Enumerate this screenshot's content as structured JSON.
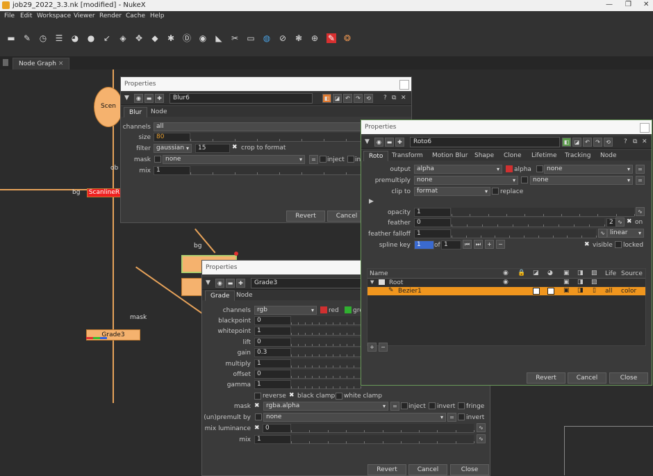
{
  "window": {
    "title": "job29_2022_3.3.nk [modified] - NukeX"
  },
  "menu": [
    "File",
    "Edit",
    "Workspace",
    "Viewer",
    "Render",
    "Cache",
    "Help"
  ],
  "nodegraph": {
    "tab": "Node Graph",
    "labels": {
      "ob": "ob",
      "bg_left": "bg",
      "scanline": "ScanlineR",
      "bg_mid": "bg",
      "mask": "mask",
      "grade_node": "Grade3",
      "scene": "Scen"
    }
  },
  "blur_panel": {
    "title": "Properties",
    "node_name": "Blur6",
    "tabs": [
      "Blur",
      "Node"
    ],
    "channels": {
      "label": "channels",
      "value": "all"
    },
    "size": {
      "label": "size",
      "value": "80"
    },
    "filter": {
      "label": "filter",
      "value": "gaussian",
      "quality": "15",
      "crop_label": "crop to format"
    },
    "mask": {
      "label": "mask",
      "value": "none",
      "inject_label": "inject",
      "invert_label": "in"
    },
    "mix": {
      "label": "mix",
      "value": "1"
    },
    "buttons": {
      "revert": "Revert",
      "cancel": "Cancel"
    }
  },
  "grade_panel": {
    "title": "Properties",
    "node_name": "Grade3",
    "tabs": [
      "Grade",
      "Node"
    ],
    "channels": {
      "label": "channels",
      "value": "rgb",
      "red": "red",
      "green": "gre"
    },
    "rows": [
      {
        "label": "blackpoint",
        "value": "0"
      },
      {
        "label": "whitepoint",
        "value": "1"
      },
      {
        "label": "lift",
        "value": "0"
      },
      {
        "label": "gain",
        "value": "0.3"
      },
      {
        "label": "multiply",
        "value": "1"
      },
      {
        "label": "offset",
        "value": "0"
      },
      {
        "label": "gamma",
        "value": "1"
      }
    ],
    "clamp": {
      "reverse": "reverse",
      "black": "black clamp",
      "white": "white clamp"
    },
    "mask": {
      "label": "mask",
      "value": "rgba.alpha",
      "inject": "inject",
      "invert": "invert",
      "fringe": "fringe"
    },
    "unpremult": {
      "label": "(un)premult by",
      "value": "none",
      "invert": "invert"
    },
    "mix_luminance": {
      "label": "mix luminance",
      "value": "0"
    },
    "mix": {
      "label": "mix",
      "value": "1"
    },
    "buttons": {
      "revert": "Revert",
      "cancel": "Cancel",
      "close": "Close"
    }
  },
  "roto_panel": {
    "title": "Properties",
    "node_name": "Roto6",
    "tabs": [
      "Roto",
      "Transform",
      "Motion Blur",
      "Shape",
      "Clone",
      "Lifetime",
      "Tracking",
      "Node"
    ],
    "output": {
      "label": "output",
      "value": "alpha",
      "alpha_label": "alpha",
      "second": "none"
    },
    "premultiply": {
      "label": "premultiply",
      "value": "none",
      "second": "none"
    },
    "clip_to": {
      "label": "clip to",
      "value": "format",
      "replace": "replace"
    },
    "opacity": {
      "label": "opacity",
      "value": "1"
    },
    "feather": {
      "label": "feather",
      "value": "0",
      "count": "2",
      "on": "on"
    },
    "feather_falloff": {
      "label": "feather falloff",
      "value": "1",
      "mode": "linear"
    },
    "spline_key": {
      "label": "spline key",
      "value": "1",
      "of": "of",
      "total": "1",
      "visible": "visible",
      "locked": "locked"
    },
    "columns": {
      "name": "Name",
      "life": "Life",
      "source": "Source"
    },
    "tree": [
      {
        "name": "Root"
      },
      {
        "name": "Bezier1",
        "life": "all",
        "source": "color"
      }
    ],
    "buttons": {
      "revert": "Revert",
      "cancel": "Cancel",
      "close": "Close"
    }
  },
  "colors": {
    "accent": "#f0a030",
    "node": "#f5b26e",
    "selected_row": "#f0961e"
  }
}
